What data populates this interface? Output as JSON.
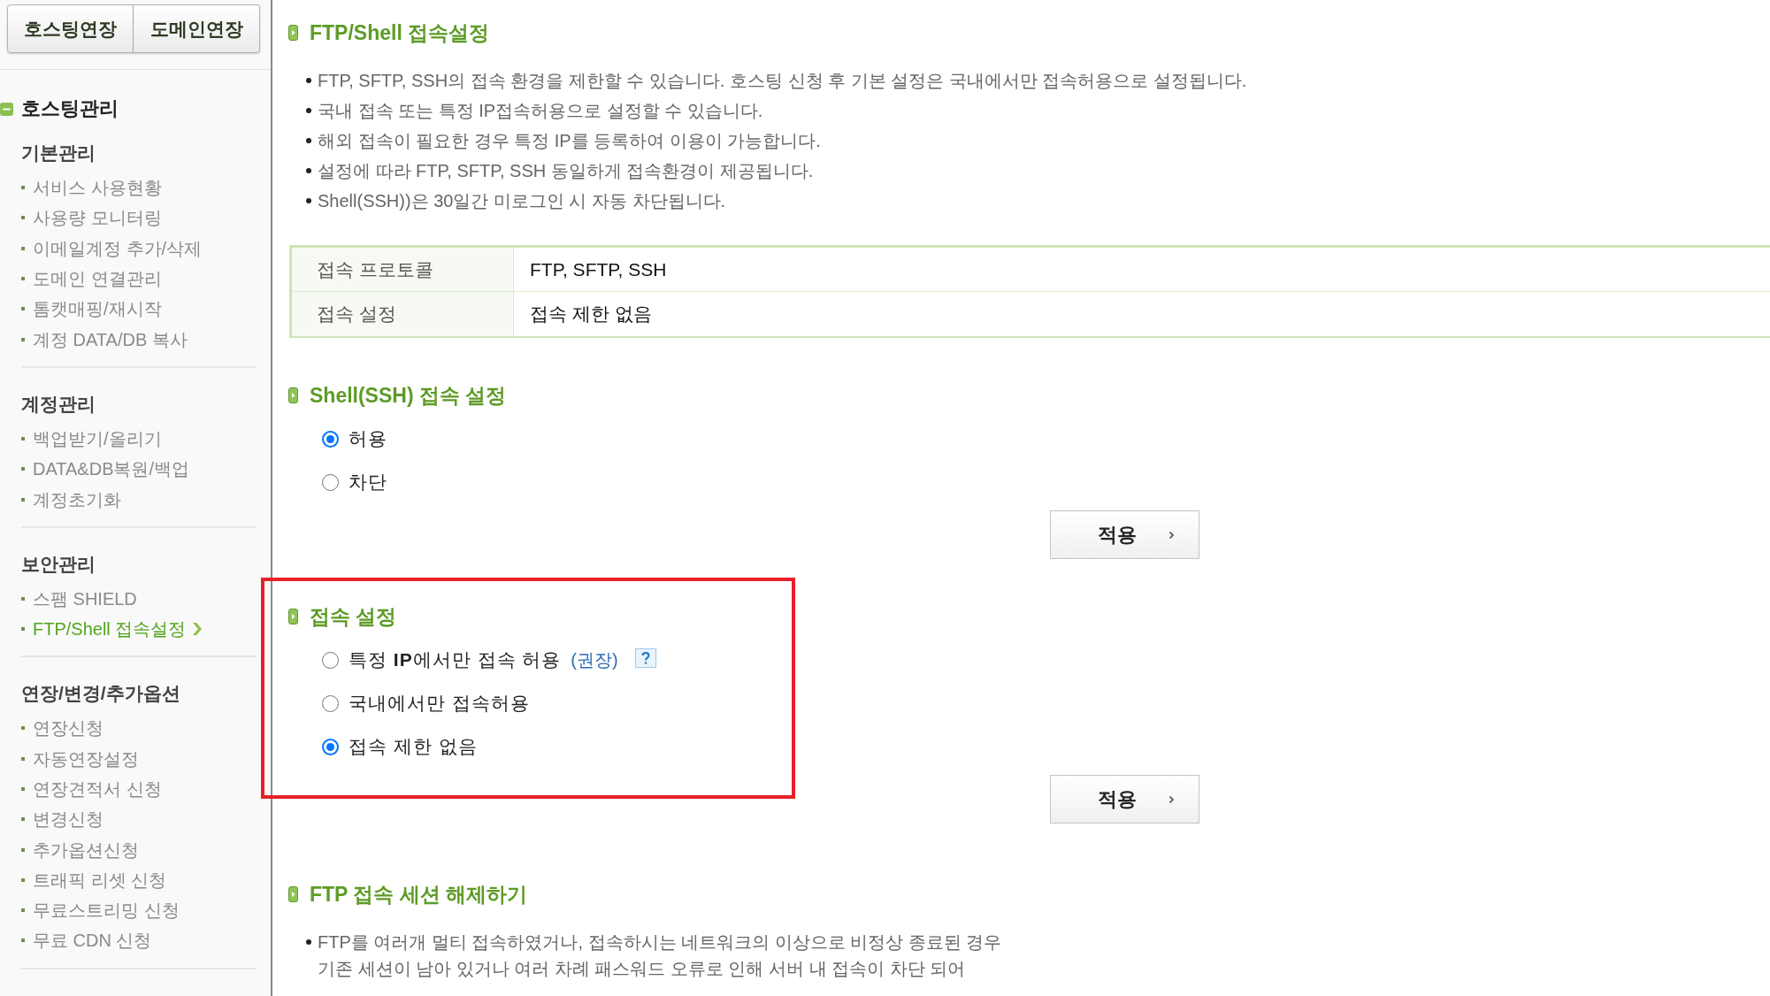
{
  "sidebar": {
    "top_buttons": [
      {
        "label": "호스팅연장"
      },
      {
        "label": "도메인연장"
      }
    ],
    "menu": {
      "title": "호스팅관리",
      "expanded": true,
      "groups": [
        {
          "title": "기본관리",
          "items": [
            {
              "label": "서비스 사용현황",
              "selected": false
            },
            {
              "label": "사용량 모니터링",
              "selected": false
            },
            {
              "label": "이메일계정 추가/삭제",
              "selected": false
            },
            {
              "label": "도메인 연결관리",
              "selected": false
            },
            {
              "label": "톰캣매핑/재시작",
              "selected": false
            },
            {
              "label": "계정 DATA/DB 복사",
              "selected": false
            }
          ]
        },
        {
          "title": "계정관리",
          "items": [
            {
              "label": "백업받기/올리기",
              "selected": false
            },
            {
              "label": "DATA&DB복원/백업",
              "selected": false
            },
            {
              "label": "계정초기화",
              "selected": false
            }
          ]
        },
        {
          "title": "보안관리",
          "items": [
            {
              "label": "스팸 SHIELD",
              "selected": false
            },
            {
              "label": "FTP/Shell 접속설정",
              "selected": true
            }
          ]
        },
        {
          "title": "연장/변경/추가옵션",
          "items": [
            {
              "label": "연장신청",
              "selected": false
            },
            {
              "label": "자동연장설정",
              "selected": false
            },
            {
              "label": "연장견적서 신청",
              "selected": false
            },
            {
              "label": "변경신청",
              "selected": false
            },
            {
              "label": "추가옵션신청",
              "selected": false
            },
            {
              "label": "트래픽 리셋 신청",
              "selected": false
            },
            {
              "label": "무료스트리밍 신청",
              "selected": false
            },
            {
              "label": "무료 CDN 신청",
              "selected": false
            }
          ]
        }
      ]
    }
  },
  "sections": [
    {
      "kind": "info",
      "title": "FTP/Shell 접속설정",
      "bullets": [
        {
          "lines": [
            "FTP, SFTP, SSH의 접속 환경을 제한할 수 있습니다. 호스팅 신청 후 기본 설정은 국내에서만 접속허용으로 설정됩니다."
          ]
        },
        {
          "lines": [
            "국내 접속 또는 특정 IP접속허용으로 설정할 수 있습니다."
          ]
        },
        {
          "lines": [
            "해외 접속이 필요한 경우 특정 IP를 등록하여 이용이 가능합니다."
          ]
        },
        {
          "lines": [
            "설정에 따라 FTP, SFTP, SSH 동일하게 접속환경이 제공됩니다."
          ]
        },
        {
          "lines": [
            "Shell(SSH))은 30일간 미로그인 시 자동 차단됩니다."
          ]
        }
      ],
      "table": {
        "rows": [
          {
            "label": "접속 프로토콜",
            "value": "FTP, SFTP, SSH"
          },
          {
            "label": "접속 설정",
            "value": "접속 제한 없음"
          }
        ]
      }
    },
    {
      "kind": "radio",
      "title": "Shell(SSH) 접속 설정",
      "options": [
        {
          "label": "허용",
          "selected": true
        },
        {
          "label": "차단",
          "selected": false
        }
      ],
      "button": "적용"
    },
    {
      "kind": "radio",
      "title": "접속 설정",
      "highlighted": true,
      "options": [
        {
          "label": "특정 **IP**에서만 접속 허용",
          "note": "(권장)",
          "help": true,
          "selected": false
        },
        {
          "label": "국내에서만 접속허용",
          "selected": false
        },
        {
          "label": "접속 제한 없음",
          "selected": true
        }
      ],
      "button": "적용"
    },
    {
      "kind": "info",
      "title": "FTP 접속 세션 해제하기",
      "bullets": [
        {
          "lines": [
            "FTP를 여러개 멀티 접속하였거나, 접속하시는 네트워크의 이상으로 비정상 종료된 경우",
            "기존 세션이 남아 있거나 여러 차례 패스워드 오류로 인해 서버 내 접속이 차단 되어"
          ]
        }
      ]
    }
  ]
}
